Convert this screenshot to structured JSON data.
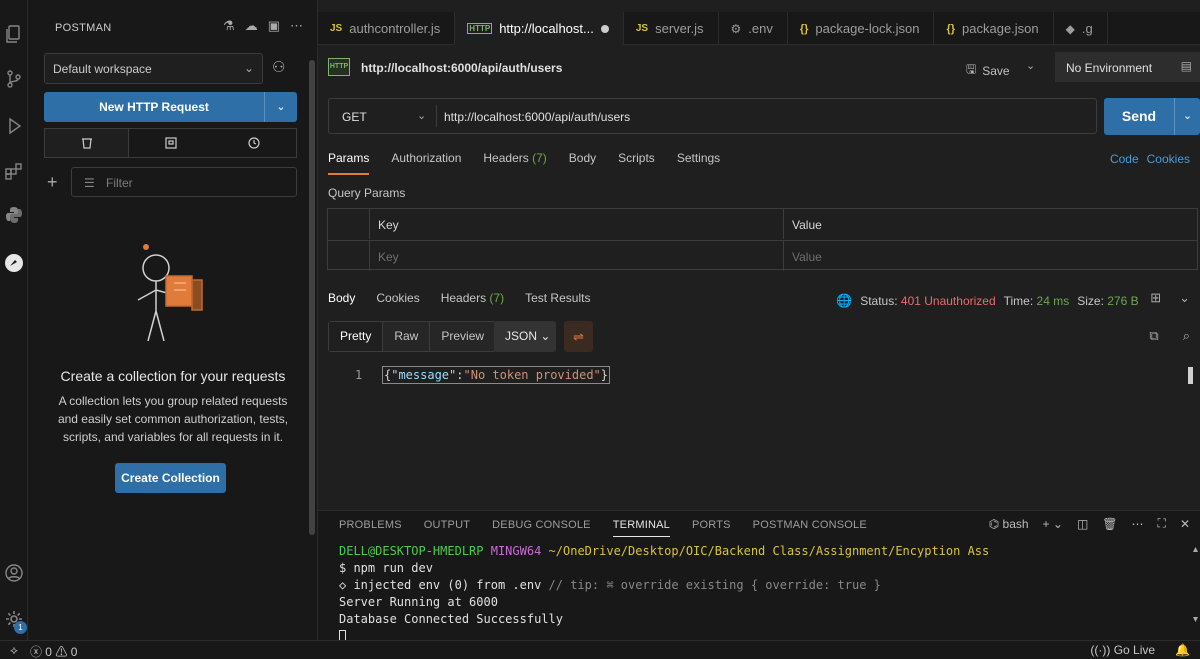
{
  "sidebar": {
    "title": "POSTMAN",
    "workspace": "Default workspace",
    "new_request": "New HTTP Request",
    "filter_placeholder": "Filter",
    "empty_title": "Create a collection for your requests",
    "empty_desc": "A collection lets you group related requests and easily set common authorization, tests, scripts, and variables for all requests in it.",
    "create_button": "Create Collection"
  },
  "tabs": [
    {
      "label": "authcontroller.js",
      "type": "js"
    },
    {
      "label": "http://localhost...",
      "type": "http"
    },
    {
      "label": "server.js",
      "type": "js"
    },
    {
      "label": ".env",
      "type": "env"
    },
    {
      "label": "package-lock.json",
      "type": "json"
    },
    {
      "label": "package.json",
      "type": "json"
    },
    {
      "label": ".g",
      "type": "other"
    }
  ],
  "request": {
    "title": "http://localhost:6000/api/auth/users",
    "save": "Save",
    "environment": "No Environment",
    "method": "GET",
    "url": "http://localhost:6000/api/auth/users",
    "send": "Send",
    "tabs": {
      "params": "Params",
      "authorization": "Authorization",
      "headers": "Headers",
      "headers_count": "(7)",
      "body": "Body",
      "scripts": "Scripts",
      "settings": "Settings"
    },
    "code": "Code",
    "cookies": "Cookies",
    "query_params": "Query Params",
    "col_key": "Key",
    "col_value": "Value",
    "key_placeholder": "Key",
    "value_placeholder": "Value"
  },
  "response": {
    "tabs": {
      "body": "Body",
      "cookies": "Cookies",
      "headers": "Headers",
      "headers_count": "(7)",
      "test_results": "Test Results"
    },
    "status_label": "Status:",
    "status_value": "401 Unauthorized",
    "time_label": "Time:",
    "time_value": "24 ms",
    "size_label": "Size:",
    "size_value": "276 B",
    "formats": {
      "pretty": "Pretty",
      "raw": "Raw",
      "preview": "Preview"
    },
    "json": "JSON",
    "line_number": "1",
    "body_key": "\"message\"",
    "body_value": "\"No token provided\""
  },
  "panel": {
    "tabs": {
      "problems": "PROBLEMS",
      "output": "OUTPUT",
      "debug": "DEBUG CONSOLE",
      "terminal": "TERMINAL",
      "ports": "PORTS",
      "postman": "POSTMAN CONSOLE"
    },
    "shell": "bash",
    "terminal": {
      "user": "DELL@DESKTOP-HMEDLRP",
      "env": "MINGW64",
      "path": "~/OneDrive/Desktop/OIC/Backend Class/Assignment/Encyption Ass",
      "cmd": "$ npm run dev",
      "line3a": "◇ injected env (0) from .env",
      "line3b": "// tip: ⌘ override existing { override: true }",
      "line4": "Server Running at 6000",
      "line5": "Database Connected Successfully"
    }
  },
  "statusbar": {
    "errors": "0",
    "warnings": "0",
    "golive": "Go Live"
  },
  "notifications_count": "1",
  "colors": {
    "accent_blue": "#2d6fa6",
    "accent_orange": "#e07b39",
    "error": "#e86c6c",
    "success": "#6aa84f"
  }
}
